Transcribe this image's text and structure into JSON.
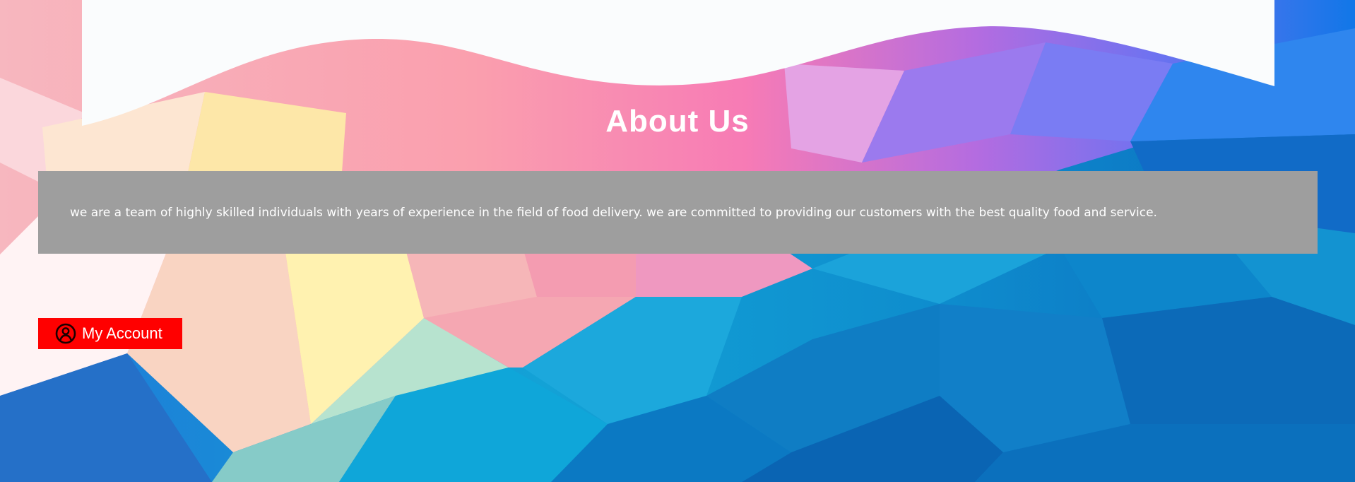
{
  "about": {
    "title": "About Us",
    "description": "we are a team of highly skilled individuals with years of experience in the field of food delivery. we are committed to providing our customers with the best quality food and service."
  },
  "account_button": {
    "label": "My Account",
    "icon": "user-circle-icon",
    "color": "#ff0000"
  },
  "colors": {
    "panel": "#9e9e9e",
    "header_wave": "#fafcfd"
  }
}
